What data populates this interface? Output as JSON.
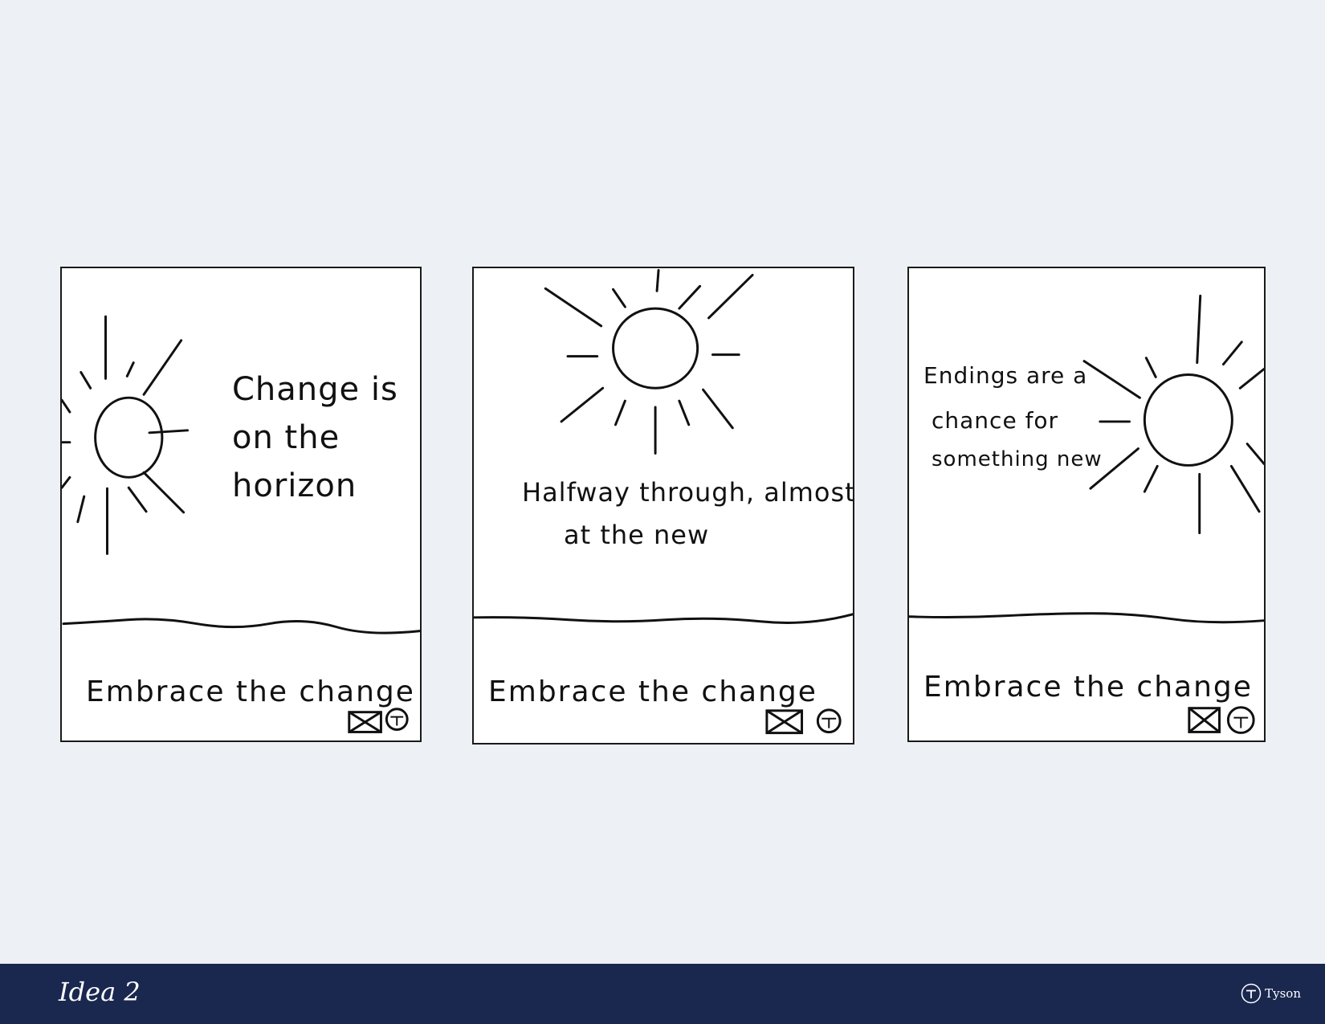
{
  "panels": [
    {
      "headline": [
        "Change is",
        "on the",
        "horizon"
      ],
      "caption": "Embrace the change",
      "icons": [
        "envelope-icon",
        "tyson-logo-icon"
      ]
    },
    {
      "headline": [
        "Halfway through, almost",
        "at the new"
      ],
      "caption": "Embrace the change",
      "icons": [
        "envelope-icon",
        "tyson-logo-icon"
      ]
    },
    {
      "headline": [
        "Endings are a",
        "chance for",
        "something new"
      ],
      "caption": "Embrace the change",
      "icons": [
        "envelope-icon",
        "tyson-logo-icon"
      ]
    }
  ],
  "footer": {
    "title": "Idea 2",
    "brand": "Tyson",
    "background_color": "#1a2850"
  },
  "colors": {
    "page_background": "#edf0f5",
    "panel_background": "#ffffff",
    "ink": "#111111"
  }
}
